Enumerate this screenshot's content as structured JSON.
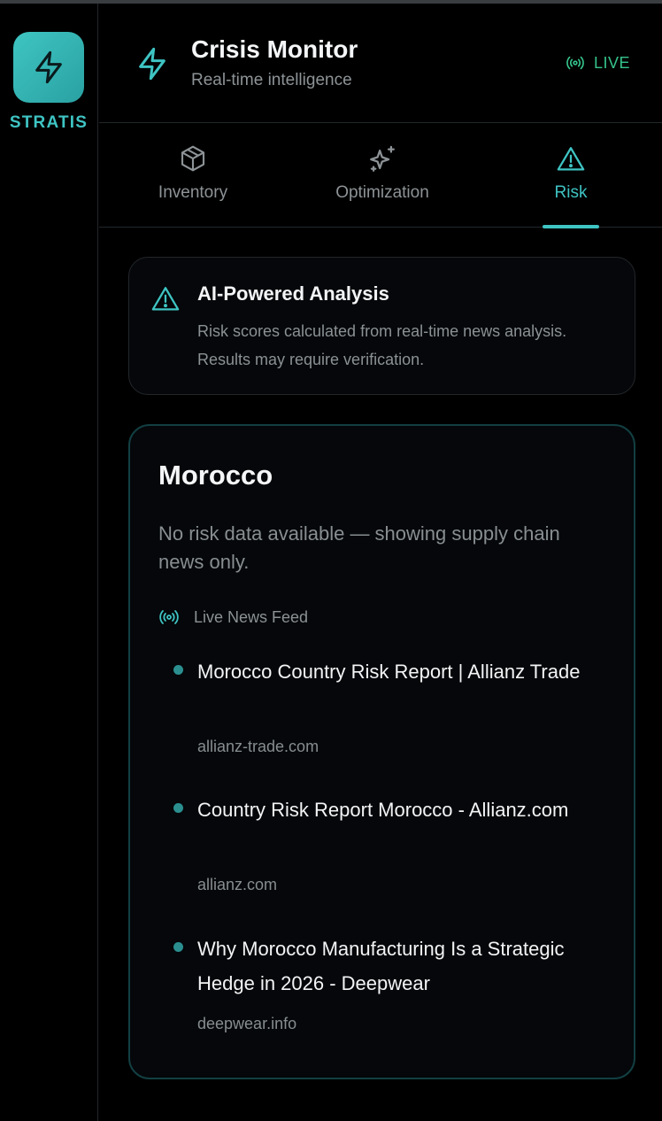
{
  "brand": {
    "name": "STRATIS",
    "logo_icon": "bolt-icon",
    "accent": "#3ec4c3"
  },
  "header": {
    "title": "Crisis Monitor",
    "subtitle": "Real-time intelligence",
    "icon": "bolt-icon",
    "live_label": "LIVE",
    "live_color": "#35c38b"
  },
  "tabs": [
    {
      "label": "Inventory",
      "icon": "package-icon",
      "active": false
    },
    {
      "label": "Optimization",
      "icon": "sparkles-icon",
      "active": false
    },
    {
      "label": "Risk",
      "icon": "warning-icon",
      "active": true
    }
  ],
  "notice": {
    "icon": "warning-icon",
    "title": "AI-Powered Analysis",
    "text": "Risk scores calculated from real-time news analysis. Results may require verification."
  },
  "country_card": {
    "country": "Morocco",
    "no_risk_text": "No risk data available — showing supply chain news only.",
    "feed_label": "Live News Feed",
    "feed_icon": "broadcast-icon",
    "news": [
      {
        "headline": "Morocco Country Risk Report | Allianz Trade",
        "source": "allianz-trade.com"
      },
      {
        "headline": "Country Risk Report Morocco - Allianz.com",
        "source": "allianz.com"
      },
      {
        "headline": "Why Morocco Manufacturing Is a Strategic Hedge in 2026 - Deepwear",
        "source": "deepwear.info"
      }
    ]
  }
}
